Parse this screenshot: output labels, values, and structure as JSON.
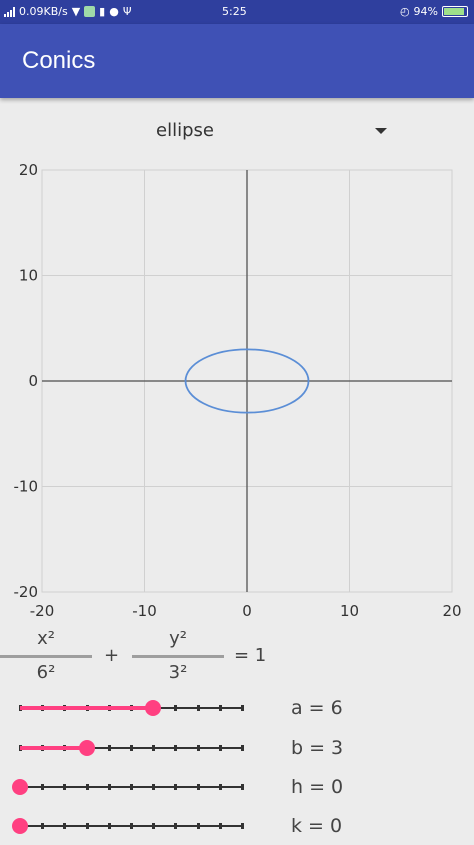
{
  "status_bar": {
    "speed": "0.09KB/s",
    "time": "5:25",
    "battery": "94%"
  },
  "app": {
    "title": "Conics"
  },
  "spinner": {
    "selected": "ellipse"
  },
  "equation": {
    "term1_num": "x²",
    "term1_den": "6²",
    "plus": "+",
    "term2_num": "y²",
    "term2_den": "3²",
    "rhs": "= 1"
  },
  "sliders": [
    {
      "label": "a = 6",
      "value": 6,
      "min": 0,
      "max": 10
    },
    {
      "label": "b = 3",
      "value": 3,
      "min": 0,
      "max": 10
    },
    {
      "label": "h = 0",
      "value": 0,
      "min": 0,
      "max": 10
    },
    {
      "label": "k = 0",
      "value": 0,
      "min": 0,
      "max": 10
    }
  ],
  "colors": {
    "primary": "#3f51b5",
    "status_bar": "#2f3f9e",
    "accent": "#ff4081",
    "curve": "#5b8ed6"
  },
  "chart_data": {
    "type": "line",
    "xlim": [
      -20,
      20
    ],
    "ylim": [
      -20,
      20
    ],
    "x_ticks": [
      -20,
      -10,
      0,
      10,
      20
    ],
    "y_ticks": [
      -20,
      -10,
      0,
      10,
      20
    ],
    "grid": true,
    "series": [
      {
        "curve": "ellipse",
        "center": [
          0,
          0
        ],
        "semi_axis_x": 6,
        "semi_axis_y": 3
      }
    ]
  }
}
